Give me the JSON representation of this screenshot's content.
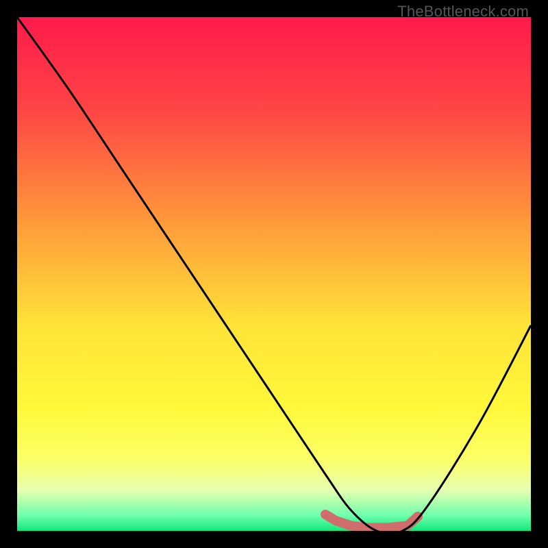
{
  "watermark": "TheBottleneck.com",
  "colors": {
    "frame": "#000000",
    "curve": "#000000",
    "marker": "#cf6d6c",
    "gradient_stops": [
      {
        "pct": 0,
        "color": "#ff1a4c"
      },
      {
        "pct": 18,
        "color": "#ff4545"
      },
      {
        "pct": 40,
        "color": "#ff9a3a"
      },
      {
        "pct": 60,
        "color": "#ffe338"
      },
      {
        "pct": 76,
        "color": "#fff83a"
      },
      {
        "pct": 86,
        "color": "#fbff66"
      },
      {
        "pct": 92,
        "color": "#e7ffb0"
      },
      {
        "pct": 97,
        "color": "#6fffad"
      },
      {
        "pct": 100,
        "color": "#10e77a"
      }
    ]
  },
  "chart_data": {
    "type": "line",
    "title": "",
    "xlabel": "",
    "ylabel": "",
    "xlim": [
      0,
      100
    ],
    "ylim": [
      0,
      100
    ],
    "series": [
      {
        "name": "bottleneck-curve",
        "x": [
          0,
          10,
          20,
          30,
          40,
          50,
          60,
          65,
          70,
          75,
          80,
          90,
          100
        ],
        "y": [
          100,
          86,
          71,
          56,
          41,
          26,
          11,
          4,
          0,
          0,
          5,
          21,
          40
        ]
      }
    ],
    "markers": {
      "name": "highlight-band",
      "x": [
        60,
        62,
        65,
        68,
        72,
        76,
        78
      ],
      "y": [
        3.2,
        2.0,
        1.0,
        0.6,
        0.6,
        1.0,
        2.8
      ]
    }
  }
}
